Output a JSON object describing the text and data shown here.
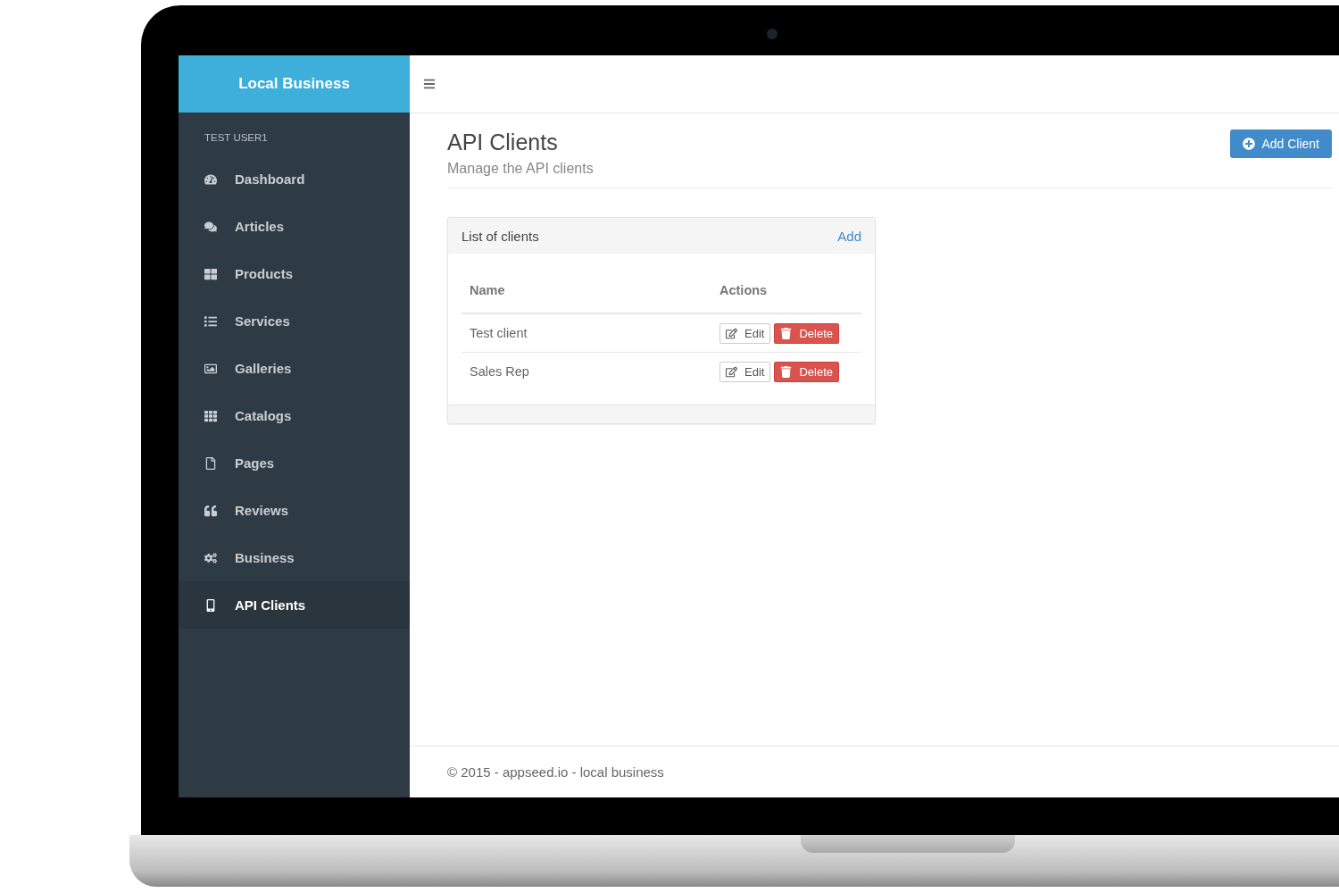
{
  "brand": "Local Business",
  "user": "TEST USER1",
  "sidebar": {
    "items": [
      {
        "label": "Dashboard",
        "selected": false
      },
      {
        "label": "Articles",
        "selected": false
      },
      {
        "label": "Products",
        "selected": false
      },
      {
        "label": "Services",
        "selected": false
      },
      {
        "label": "Galleries",
        "selected": false
      },
      {
        "label": "Catalogs",
        "selected": false
      },
      {
        "label": "Pages",
        "selected": false
      },
      {
        "label": "Reviews",
        "selected": false
      },
      {
        "label": "Business",
        "selected": false
      },
      {
        "label": "API Clients",
        "selected": true
      }
    ]
  },
  "page": {
    "title": "API Clients",
    "subtitle": "Manage the API clients",
    "action": "Add Client"
  },
  "panel": {
    "title": "List of clients",
    "link": "Add",
    "table": {
      "columns": [
        "Name",
        "Actions"
      ],
      "rows": [
        {
          "name": "Test client",
          "edit": "Edit",
          "delete": "Delete"
        },
        {
          "name": "Sales Rep",
          "edit": "Edit",
          "delete": "Delete"
        }
      ]
    }
  },
  "footer": "© 2015 - appseed.io - local business"
}
